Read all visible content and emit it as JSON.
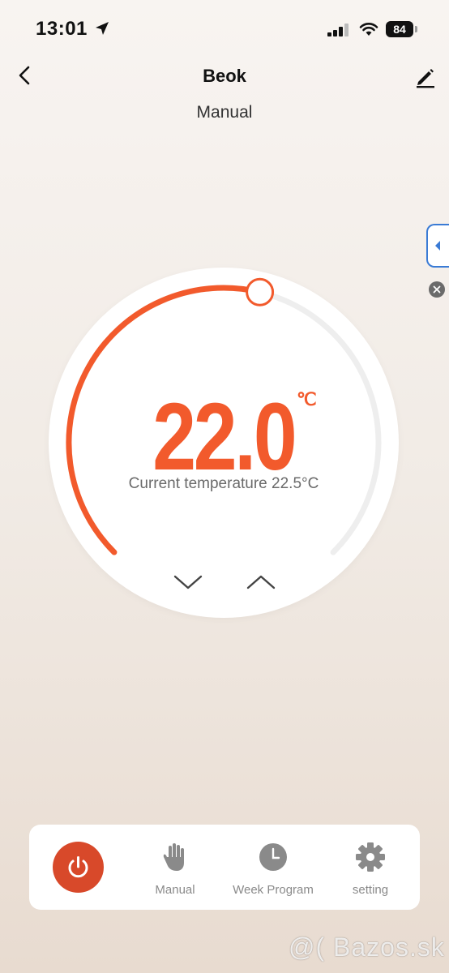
{
  "status_bar": {
    "time": "13:01",
    "battery": "84"
  },
  "header": {
    "title": "Beok",
    "mode": "Manual"
  },
  "thermostat": {
    "setpoint": "22.0",
    "unit": "℃",
    "current_label": "Current temperature 22.5°C",
    "setpoint_fraction": 0.55
  },
  "tabbar": {
    "tabs": [
      {
        "label": "Manual",
        "icon": "hand-icon"
      },
      {
        "label": "Week Program",
        "icon": "clock-icon"
      },
      {
        "label": "setting",
        "icon": "gear-icon"
      }
    ]
  },
  "colors": {
    "accent": "#f25a2c",
    "power": "#d8492a",
    "icon_gray": "#8a8a8a"
  },
  "watermark": "@( Bazos.sk"
}
